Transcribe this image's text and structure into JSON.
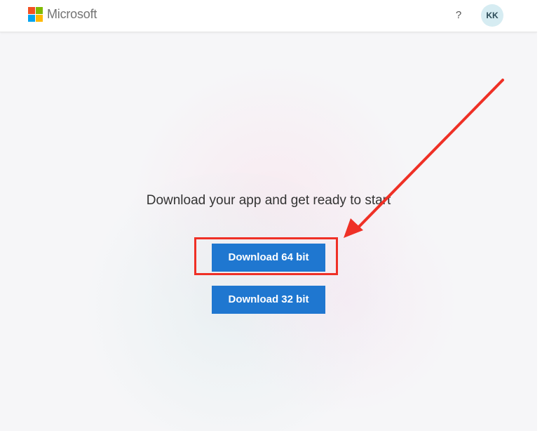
{
  "header": {
    "brand": "Microsoft",
    "help_label": "?",
    "avatar_initials": "KK"
  },
  "main": {
    "title": "Download your app and get ready to start",
    "buttons": {
      "download_64": "Download 64 bit",
      "download_32": "Download 32 bit"
    }
  },
  "colors": {
    "logo_red": "#f25022",
    "logo_green": "#7fba00",
    "logo_blue": "#00a4ef",
    "logo_yellow": "#ffb900",
    "button_blue": "#1f77d0",
    "annotation_red": "#ef3026"
  },
  "icons": {
    "help": "question-mark-icon",
    "arrow": "red-arrow-annotation"
  }
}
